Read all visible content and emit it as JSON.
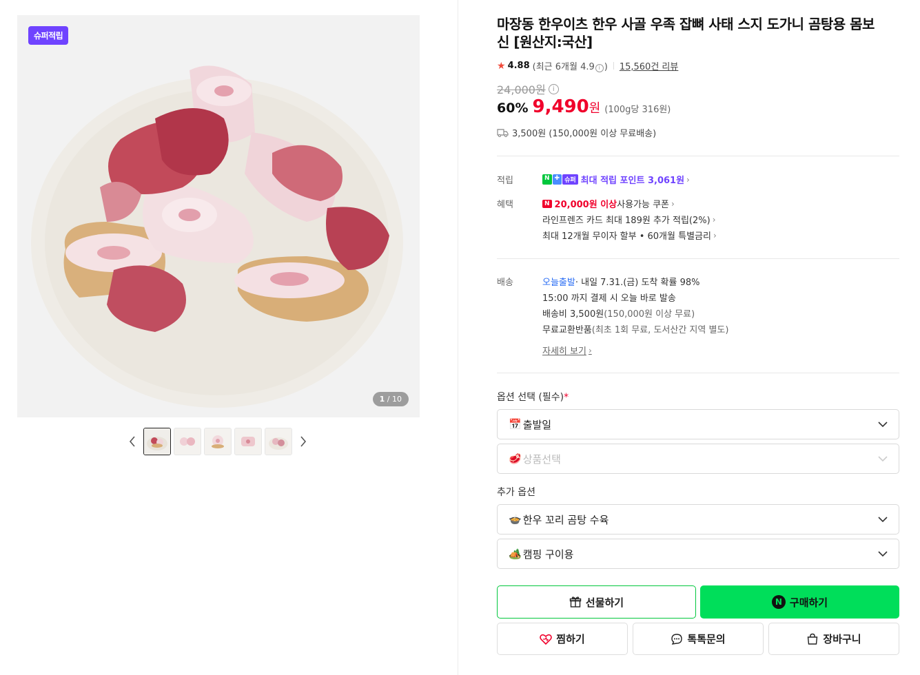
{
  "gallery": {
    "badge": "슈퍼적립",
    "counter_current": "1",
    "counter_total": " / 10",
    "thumbnail_count": 5
  },
  "product": {
    "title": "마장동 한우이츠 한우 사골 우족 잡뼈 사태 스지 도가니 곰탕용 몸보신 [원산지:국산]",
    "rating": "4.88",
    "recent_rating": "(최근 6개월 4.9",
    "recent_rating_end": ")",
    "review_count": "15,560건 리뷰",
    "original_price": "24,000원",
    "discount_pct": "60%",
    "price": "9,490",
    "price_won": "원",
    "unit_price": "(100g당 316원)",
    "shipping_summary": "3,500원 (150,000원 이상 무료배송)"
  },
  "benefits": {
    "points_label": "적립",
    "points_text": "최대 적립 포인트 3,061원",
    "benefit_label": "혜택",
    "coupon_highlight": "20,000원 이상",
    "coupon_rest": " 사용가능 쿠폰",
    "card_text": "라인프렌즈 카드 최대 189원 추가 적립(2%)",
    "installment_text": "최대 12개월 무이자 할부 • 60개월 특별금리"
  },
  "delivery": {
    "label": "배송",
    "today_badge": "오늘출발",
    "arrival": " · 내일 7.31.(금) 도착 확률 98%",
    "cutoff": "15:00 까지 결제 시 오늘 바로 발송",
    "fee": "배송비 3,500원",
    "fee_note": " (150,000원 이상 무료)",
    "exchange": "무료교환반품",
    "exchange_note": " (최초 1회 무료, 도서산간 지역 별도)",
    "more_link": "자세히 보기"
  },
  "options": {
    "required_label": "옵션 선택 (필수)",
    "required_mark": "*",
    "select1": "출발일",
    "select1_icon": "📅",
    "select2": "상품선택",
    "select2_icon": "🥩",
    "additional_label": "추가 옵션",
    "select3": "한우 꼬리 곰탕 수육",
    "select3_icon": "🍲",
    "select4": "캠핑 구이용",
    "select4_icon": "🏕️"
  },
  "actions": {
    "gift": "선물하기",
    "buy": "구매하기",
    "buy_n": "N",
    "wish": "찜하기",
    "talk": "톡톡문의",
    "cart": "장바구니"
  },
  "colors": {
    "accent_green": "#00de5a",
    "price_red": "#f0002b",
    "super_purple": "#6f43ff"
  }
}
